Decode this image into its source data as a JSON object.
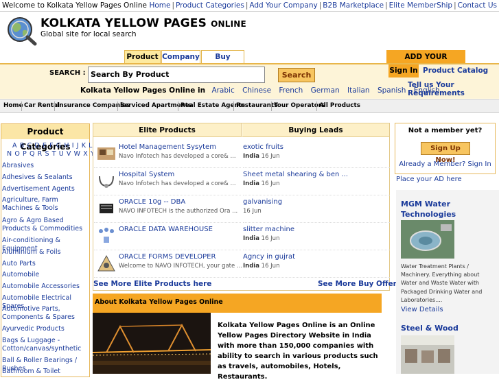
{
  "topbar": {
    "welcome": "Welcome to Kolkata Yellow Pages Online",
    "links": [
      "Home",
      "Product Categories",
      "Add Your Company",
      "B2B Marketplace",
      "Elite MemberShip",
      "Contact Us"
    ]
  },
  "header": {
    "brand": "KOLKATA YELLOW PAGES",
    "brand_suffix": "ONLINE",
    "tagline": "Global site for local search"
  },
  "search": {
    "tabs": [
      "Product",
      "Company",
      "Buy Offers"
    ],
    "label": "SEARCH :",
    "value": "Search By Product",
    "button": "Search",
    "lang_intro": "Kolkata Yellow Pages Online in",
    "languages": [
      "Arabic",
      "Chinese",
      "French",
      "German",
      "Italian",
      "Spanish",
      "English"
    ]
  },
  "account": {
    "add_company": "ADD YOUR COMPANY",
    "sign_in": "Sign In",
    "catalog": "Product Catalog",
    "tell_us": "Tell us Your Requirements"
  },
  "nav": [
    "Home",
    "Car Rental",
    "Insurance Companies",
    "Serviced Apartments",
    "Real Estate Agents",
    "Restaurants",
    "Tour Operators",
    "All Products"
  ],
  "categories": {
    "title": "Product Categories",
    "alpha_row1": "A B C D E F G H I J K L M",
    "alpha_row2": "N O P Q R S T U V W X Y Z",
    "items": [
      "Abrasives",
      "Adhesives & Sealants",
      "Advertisement Agents",
      "Agriculture, Farm Machines & Tools",
      "Agro & Agro Based Products & Commodities",
      "Air-conditioning & Equipment",
      "Aluminium & Foils",
      "Auto Parts",
      "Automobile",
      "Automobile Accessories",
      "Automobile Electrical Spares",
      "Automotive Parts, Components & Spares",
      "Ayurvedic Products",
      "Bags & Luggage - Cotton/canvas/synthetic",
      "Ball & Roller Bearings / Bushes",
      "Bathroom & Toilet"
    ]
  },
  "elite": {
    "heading": "Elite Products",
    "items": [
      {
        "title": "Hotel Management Sysytem",
        "desc": "Navo Infotech has developed a core& ...",
        "icon": "hotel-system-thumb"
      },
      {
        "title": "Hospital System",
        "desc": "Navo Infotech has developed a core& ...",
        "icon": "hospital-system-thumb"
      },
      {
        "title": "ORACLE 10g -- DBA",
        "desc": "NAVO INFOTECH is the authorized Ora ...",
        "icon": "oracle-dba-thumb"
      },
      {
        "title": "ORACLE DATA WAREHOUSE",
        "desc": "",
        "icon": "data-warehouse-thumb"
      },
      {
        "title": "ORACLE FORMS DEVELOPER",
        "desc": "Welcome to NAVO INFOTECH, your gate ...",
        "icon": "forms-developer-thumb"
      }
    ],
    "see_more": "See More Elite Products here"
  },
  "leads": {
    "heading": "Buying Leads",
    "items": [
      {
        "title": "exotic fruits",
        "country": "India",
        "date": "16 Jun"
      },
      {
        "title": "Sheet metal shearing & ben ...",
        "country": "India",
        "date": "16 Jun"
      },
      {
        "title": "galvanising",
        "country": "",
        "date": "16 Jun"
      },
      {
        "title": "slitter machine",
        "country": "India",
        "date": "16 Jun"
      },
      {
        "title": "Agncy in gujrat",
        "country": "India",
        "date": "16 Jun"
      }
    ],
    "see_more": "See More Buy Offers"
  },
  "about": {
    "heading": "About Kolkata Yellow Pages Online",
    "text": "Kolkata Yellow Pages Online is an Online Yellow Pages Directory Website in India with more than 150,000 companies with ability to search in various products such as travels, automobiles, Hotels, Restaurants."
  },
  "member": {
    "not_member": "Not a member yet?",
    "signup": "Sign Up Now!",
    "already": "Already a Member? Sign In",
    "place_ad": "Place your AD here"
  },
  "ads": {
    "ad1_title": "MGM Water Technologies",
    "ad1_desc": "Water Treatment Plants / Machinery. Everything about Water and Waste Water with Packaged Drinking Water and Laboratories....",
    "ad1_link": "View Details",
    "ad2_title": "Steel & Wood"
  },
  "colors": {
    "accent": "#f5a623",
    "link": "#1a3a9a",
    "band": "#fdf4d8"
  }
}
